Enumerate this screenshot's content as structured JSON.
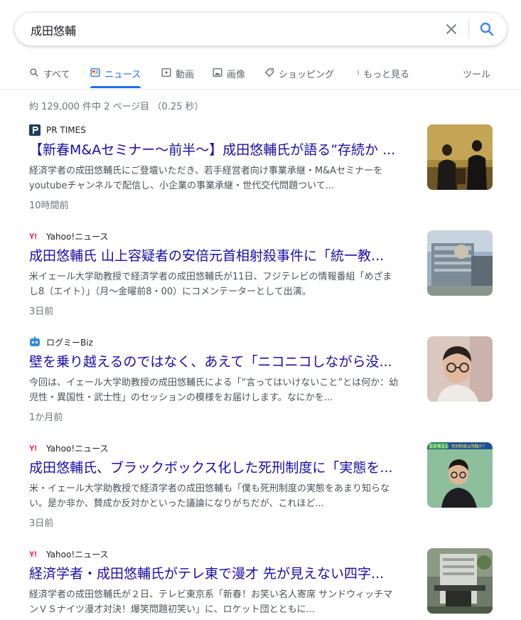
{
  "search": {
    "query": "成田悠輔"
  },
  "tabs": [
    {
      "label": "すべて",
      "icon": "search-icon"
    },
    {
      "label": "ニュース",
      "icon": "news-icon",
      "active": true
    },
    {
      "label": "動画",
      "icon": "video-icon"
    },
    {
      "label": "画像",
      "icon": "image-icon"
    },
    {
      "label": "ショッピング",
      "icon": "tag-icon"
    },
    {
      "label": "もっと見る",
      "icon": "more-vert-icon"
    }
  ],
  "tools_label": "ツール",
  "stats_text": "約 129,000 件中 2 ページ目 （0.25 秒）",
  "results": [
    {
      "source": "PR TIMES",
      "title": "【新春M&Aセミナー〜前半〜】成田悠輔氏が語る”存続か ...",
      "snippet": "経済学者の成田悠輔氏にご登壇いただき、若手経営者向け事業承継・M&Aセミナーをyoutubeチャンネルで配信し、小企業の事業承継・世代交代問題ついて...",
      "time": "10時間前"
    },
    {
      "source": "Yahoo!ニュース",
      "title": "成田悠輔氏 山上容疑者の安倍元首相射殺事件に「統一教...",
      "snippet": "米イェール大学助教授で経済学者の成田悠輔氏が11日、フジテレビの情報番組「めざまし8（エイト）」（月〜金曜前8・00）にコメンテーターとして出演。",
      "time": "3日前"
    },
    {
      "source": "ログミーBiz",
      "title": "壁を乗り越えるのではなく、あえて「ニコニコしながら没...",
      "snippet": "今回は、イェール大学助教授の成田悠輔氏による「“言ってはいけないこと”とは何か：幼児性・異国性・武士性」のセッションの模様をお届けします。なにかを...",
      "time": "1か月前"
    },
    {
      "source": "Yahoo!ニュース",
      "title": "成田悠輔氏、ブラックボックス化した死刑制度に「実態を...",
      "snippet": "米・イェール大学助教授で経済学者の成田悠輔も「僕も死刑制度の実態をあまり知らない。是か非か、賛成か反対かといった議論になりがちだが、これほど...",
      "time": "3日前"
    },
    {
      "source": "Yahoo!ニュース",
      "title": "経済学者・成田悠輔氏がテレ東で漫才 先が見えない四字...",
      "snippet": "経済学者の成田悠輔氏が２日、テレビ東京系「新春！お笑い名人寄席 サンドウィッチマンＶＳナイツ漫才対決！爆笑問題初笑い」に、ロケット団とともに...",
      "time": ""
    }
  ],
  "thumb_texts": {
    "label1": "生を考える",
    "label2": "死刑制度は残酷か？"
  },
  "colors": {
    "link": "#1a0dab",
    "accent": "#1a73e8",
    "yahoo_red": "#ff0033",
    "prtimes_blue": "#1f3a5c",
    "logmi_blue": "#2f8be6"
  }
}
